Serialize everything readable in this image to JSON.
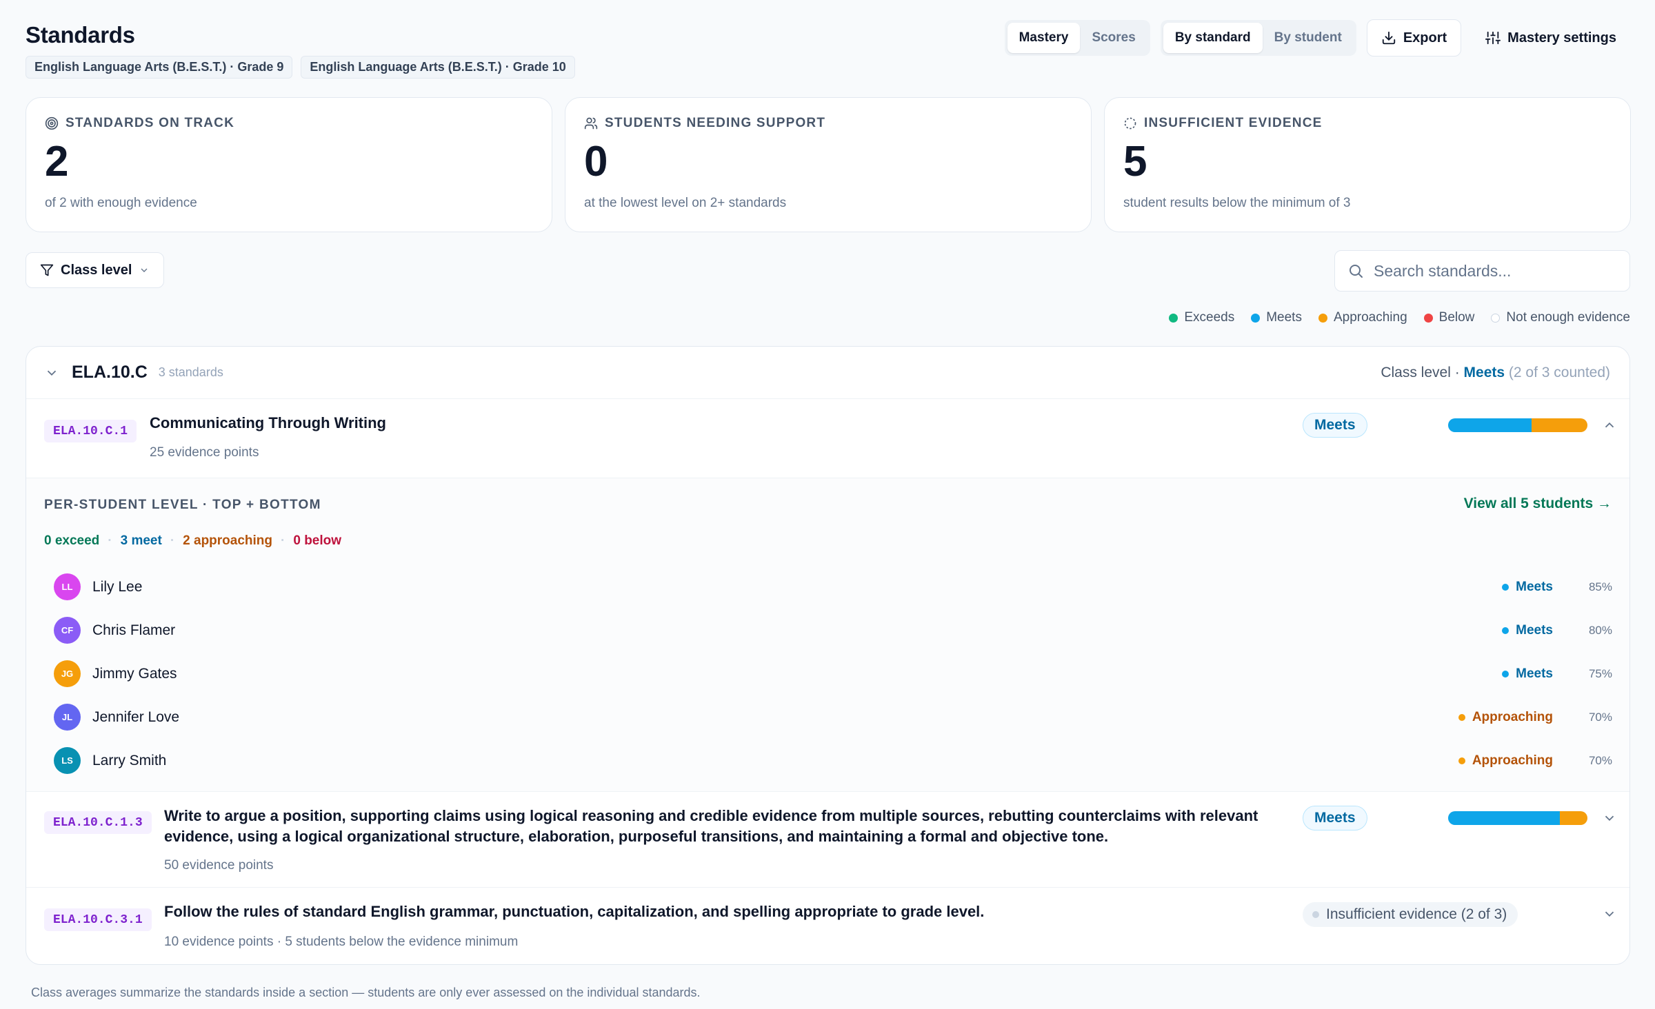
{
  "page": {
    "title": "Standards"
  },
  "chips": [
    "English Language Arts (B.E.S.T.) · Grade 9",
    "English Language Arts (B.E.S.T.) · Grade 10"
  ],
  "toolbar": {
    "view_toggle": [
      "Mastery",
      "Scores"
    ],
    "view_active": "Mastery",
    "group_toggle": [
      "By standard",
      "By student"
    ],
    "group_active": "By standard",
    "export_label": "Export",
    "settings_label": "Mastery settings"
  },
  "stats": [
    {
      "label": "STANDARDS ON TRACK",
      "value": "2",
      "sub": "of 2 with enough evidence",
      "icon": "target-icon"
    },
    {
      "label": "STUDENTS NEEDING SUPPORT",
      "value": "0",
      "sub": "at the lowest level on 2+ standards",
      "icon": "users-icon"
    },
    {
      "label": "INSUFFICIENT EVIDENCE",
      "value": "5",
      "sub": "student results below the minimum of 3",
      "icon": "dashed-circle-icon"
    }
  ],
  "filter": {
    "label": "Class level"
  },
  "search": {
    "placeholder": "Search standards..."
  },
  "legend": [
    {
      "label": "Exceeds",
      "color": "#10b981"
    },
    {
      "label": "Meets",
      "color": "#0ea5e9"
    },
    {
      "label": "Approaching",
      "color": "#f59e0b"
    },
    {
      "label": "Below",
      "color": "#ef4444"
    },
    {
      "label": "Not enough evidence",
      "color": "#cbd5e1"
    }
  ],
  "section": {
    "code": "ELA.10.C",
    "count": "3 standards",
    "level_prefix": "Class level · ",
    "level": "Meets",
    "counted": "(2 of 3 counted)"
  },
  "standards": [
    {
      "code": "ELA.10.C.1",
      "title": "Communicating Through Writing",
      "sub": "25 evidence points",
      "pill": "Meets",
      "bar": {
        "meets": 0.6,
        "approaching": 0.4
      }
    },
    {
      "code": "ELA.10.C.1.3",
      "title": "Write to argue a position, supporting claims using logical reasoning and credible evidence from multiple sources, rebutting counterclaims with relevant evidence, using a logical organizational structure, elaboration, purposeful transitions, and maintaining a formal and objective tone.",
      "sub": "50 evidence points",
      "pill": "Meets",
      "bar": {
        "meets": 0.8,
        "approaching": 0.2
      }
    },
    {
      "code": "ELA.10.C.3.1",
      "title": "Follow the rules of standard English grammar, punctuation, capitalization, and spelling appropriate to grade level.",
      "sub": "10 evidence points · 5 students below the evidence minimum",
      "pill": "Insufficient evidence (2 of 3)"
    }
  ],
  "panel": {
    "title": "PER-STUDENT LEVEL · TOP + BOTTOM",
    "view_all": "View all 5 students →",
    "counts": {
      "exceed": "0 exceed",
      "meet": "3 meet",
      "approaching": "2 approaching",
      "below": "0 below"
    },
    "students": [
      {
        "initials": "LL",
        "name": "Lily Lee",
        "level": "Meets",
        "pct": "85%",
        "color": "#d946ef"
      },
      {
        "initials": "CF",
        "name": "Chris Flamer",
        "level": "Meets",
        "pct": "80%",
        "color": "#8b5cf6"
      },
      {
        "initials": "JG",
        "name": "Jimmy Gates",
        "level": "Meets",
        "pct": "75%",
        "color": "#f59e0b"
      },
      {
        "initials": "JL",
        "name": "Jennifer Love",
        "level": "Approaching",
        "pct": "70%",
        "color": "#6366f1"
      },
      {
        "initials": "LS",
        "name": "Larry Smith",
        "level": "Approaching",
        "pct": "70%",
        "color": "#0891b2"
      }
    ]
  },
  "footnote": "Class averages summarize the standards inside a section — students are only ever assessed on the individual standards.",
  "colors": {
    "meets": "#0ea5e9",
    "approaching": "#f59e0b",
    "meets_text": "#0369a1",
    "approaching_text": "#b45309",
    "exceed_text": "#047857",
    "below_text": "#be123c"
  }
}
